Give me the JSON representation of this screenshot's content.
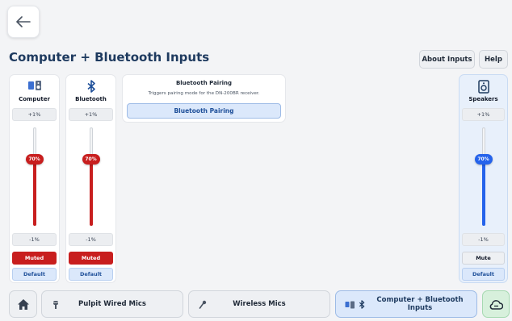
{
  "page": {
    "title": "Computer + Bluetooth Inputs"
  },
  "header": {
    "about_label": "About Inputs",
    "help_label": "Help"
  },
  "channels": [
    {
      "name": "Computer",
      "boost": "+1%",
      "level_label": "70%",
      "level": 0.7,
      "cut": "-1%",
      "state": "Muted",
      "state_active": true,
      "default_label": "Default",
      "color": "#c81e1e",
      "icon": "computer-speaker-icon"
    },
    {
      "name": "Bluetooth",
      "boost": "+1%",
      "level_label": "70%",
      "level": 0.7,
      "cut": "-1%",
      "state": "Muted",
      "state_active": true,
      "default_label": "Default",
      "color": "#c81e1e",
      "icon": "bluetooth-icon"
    },
    {
      "name": "Speakers",
      "boost": "+1%",
      "level_label": "70%",
      "level": 0.7,
      "cut": "-1%",
      "state": "Mute",
      "state_active": false,
      "default_label": "Default",
      "color": "#2563eb",
      "icon": "speaker-icon"
    }
  ],
  "pairing": {
    "title": "Bluetooth Pairing",
    "description": "Triggers pairing mode for the DN-200BR receiver.",
    "button_label": "Bluetooth Pairing"
  },
  "bottom_nav": {
    "pulpit_label": "Pulpit Wired Mics",
    "wireless_label": "Wireless Mics",
    "computer_label": "Computer + Bluetooth Inputs"
  },
  "colors": {
    "accent_red": "#c81e1e",
    "accent_blue": "#2563eb",
    "active_tab": "#dbe8fb",
    "cloud_button": "#d7f0dc"
  }
}
